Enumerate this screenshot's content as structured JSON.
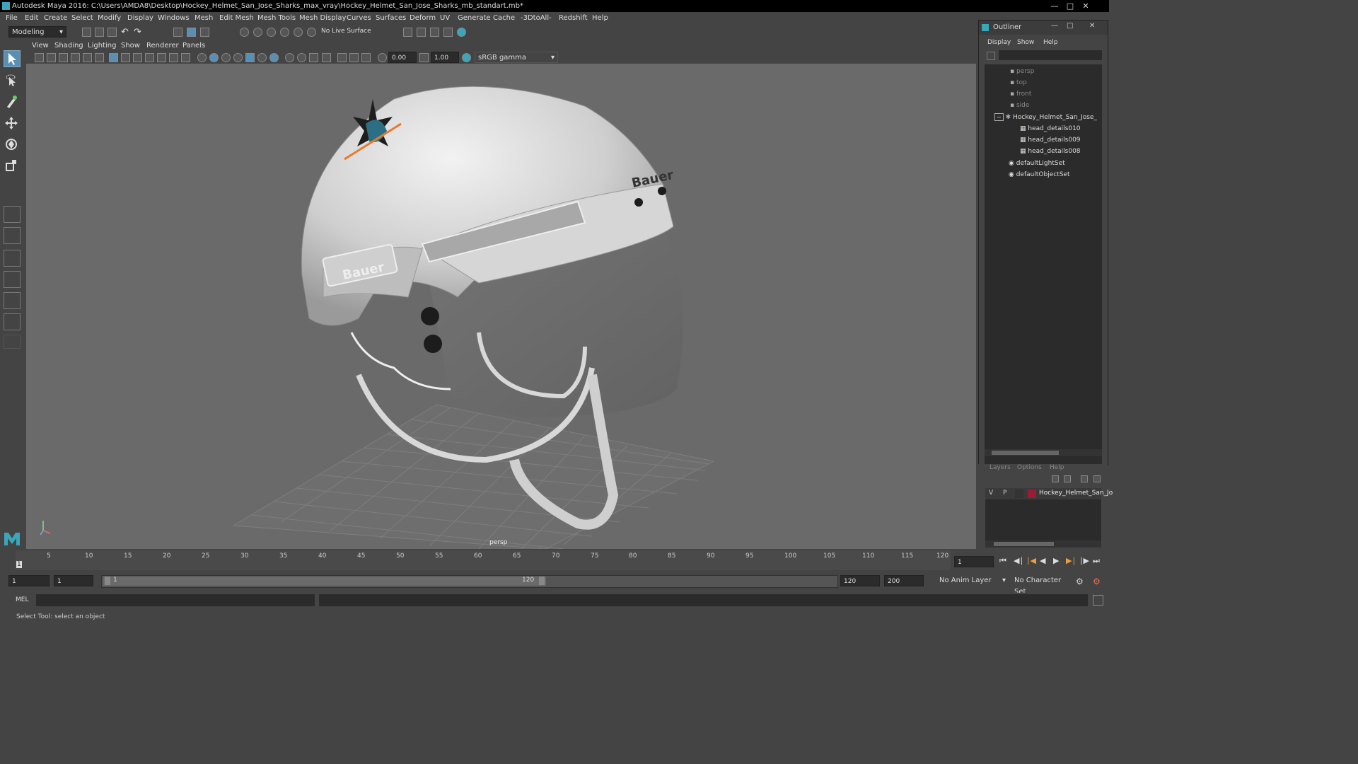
{
  "window": {
    "title": "Autodesk Maya 2016: C:\\Users\\AMDA8\\Desktop\\Hockey_Helmet_San_Jose_Sharks_max_vray\\Hockey_Helmet_San_Jose_Sharks_mb_standart.mb*"
  },
  "menu": [
    "File",
    "Edit",
    "Create",
    "Select",
    "Modify",
    "Display",
    "Windows",
    "Mesh",
    "Edit Mesh",
    "Mesh Tools",
    "Mesh Display",
    "Curves",
    "Surfaces",
    "Deform",
    "UV",
    "Generate",
    "Cache",
    "-3DtoAll-",
    "Redshift",
    "Help"
  ],
  "shelf": {
    "mode": "Modeling",
    "live_surface": "No Live Surface"
  },
  "viewport_menu": [
    "View",
    "Shading",
    "Lighting",
    "Show",
    "Renderer",
    "Panels"
  ],
  "viewport_tools": {
    "exposure": "0.00",
    "gamma": "1.00",
    "color_space": "sRGB gamma"
  },
  "viewport": {
    "camera_label": "persp",
    "logo_text": "Bauer"
  },
  "outliner": {
    "title": "Outliner",
    "menu": [
      "Display",
      "Show",
      "Help"
    ],
    "items": [
      {
        "label": "persp",
        "dim": true
      },
      {
        "label": "top",
        "dim": true
      },
      {
        "label": "front",
        "dim": true
      },
      {
        "label": "side",
        "dim": true
      },
      {
        "label": "Hockey_Helmet_San_Jose_",
        "dim": false
      },
      {
        "label": "head_details010",
        "dim": false
      },
      {
        "label": "head_details009",
        "dim": false
      },
      {
        "label": "head_details008",
        "dim": false
      },
      {
        "label": "defaultLightSet",
        "dim": false
      },
      {
        "label": "defaultObjectSet",
        "dim": false
      }
    ]
  },
  "layers": {
    "menu": [
      "Layers",
      "Options",
      "Help"
    ],
    "row": {
      "v": "V",
      "p": "P",
      "name": "Hockey_Helmet_San_Jo",
      "color": "#9b1b30"
    }
  },
  "timeline": {
    "ticks": [
      "5",
      "10",
      "15",
      "20",
      "25",
      "30",
      "35",
      "40",
      "45",
      "50",
      "55",
      "60",
      "65",
      "70",
      "75",
      "80",
      "85",
      "90",
      "95",
      "100",
      "105",
      "110",
      "115",
      "120"
    ],
    "start_marker": "1",
    "current_frame": "1"
  },
  "range": {
    "start": "1",
    "playback_start": "1",
    "slider_start": "1",
    "slider_end": "120",
    "playback_end": "120",
    "end": "200",
    "anim_layer": "No Anim Layer",
    "char_set": "No Character Set"
  },
  "mel": {
    "label": "MEL"
  },
  "status": {
    "text": "Select Tool: select an object"
  }
}
